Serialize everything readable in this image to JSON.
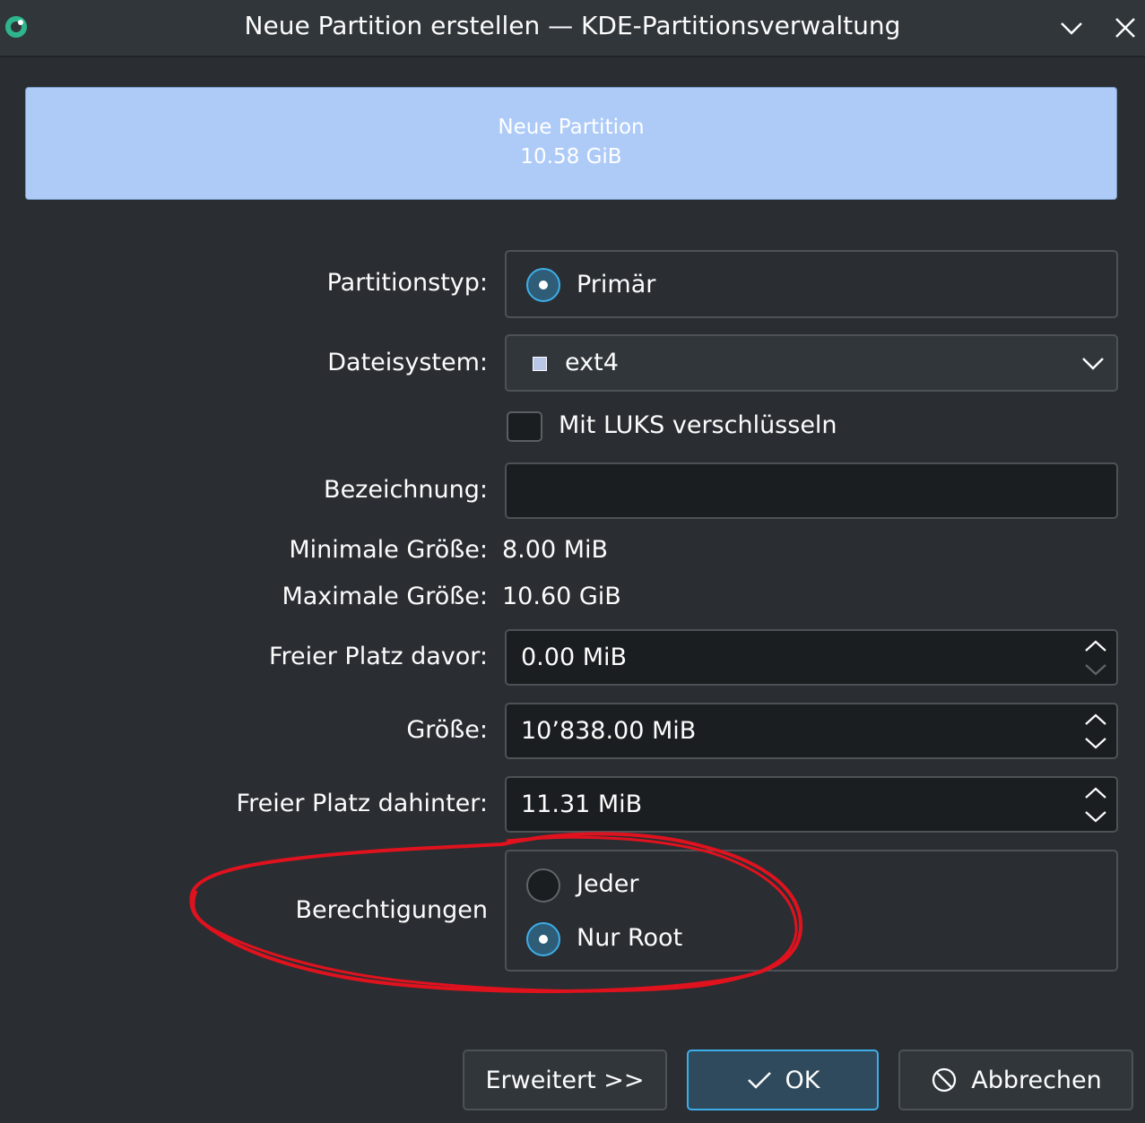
{
  "window": {
    "title": "Neue Partition erstellen — KDE-Partitionsverwaltung",
    "icons": [
      "app-logo-icon",
      "chevron-down-icon",
      "close-icon"
    ]
  },
  "preview": {
    "name": "Neue Partition",
    "size": "10.58 GiB",
    "color": "#aecbf8"
  },
  "form": {
    "partition_type": {
      "label": "Partitionstyp:",
      "value": "Primär",
      "selected": true
    },
    "filesystem": {
      "label": "Dateisystem:",
      "value": "ext4",
      "icon": "chevron-down-icon"
    },
    "luks": {
      "label": "Mit LUKS verschlüsseln",
      "checked": false
    },
    "label_field": {
      "label": "Bezeichnung:",
      "value": ""
    },
    "min_size": {
      "label": "Minimale Größe:",
      "value": "8.00 MiB"
    },
    "max_size": {
      "label": "Maximale Größe:",
      "value": "10.60 GiB"
    },
    "free_before": {
      "label": "Freier Platz davor:",
      "value": "0.00 MiB"
    },
    "size": {
      "label": "Größe:",
      "value": "10’838.00 MiB"
    },
    "free_after": {
      "label": "Freier Platz dahinter:",
      "value": "11.31 MiB"
    },
    "permissions": {
      "label": "Berechtigungen",
      "options": [
        {
          "label": "Jeder",
          "selected": false
        },
        {
          "label": "Nur Root",
          "selected": true
        }
      ]
    }
  },
  "buttons": {
    "advanced": "Erweitert >>",
    "ok": "OK",
    "cancel": "Abbrechen"
  },
  "colors": {
    "accent": "#3daee9",
    "background": "#2a2e32",
    "annotation": "#e0121e"
  }
}
